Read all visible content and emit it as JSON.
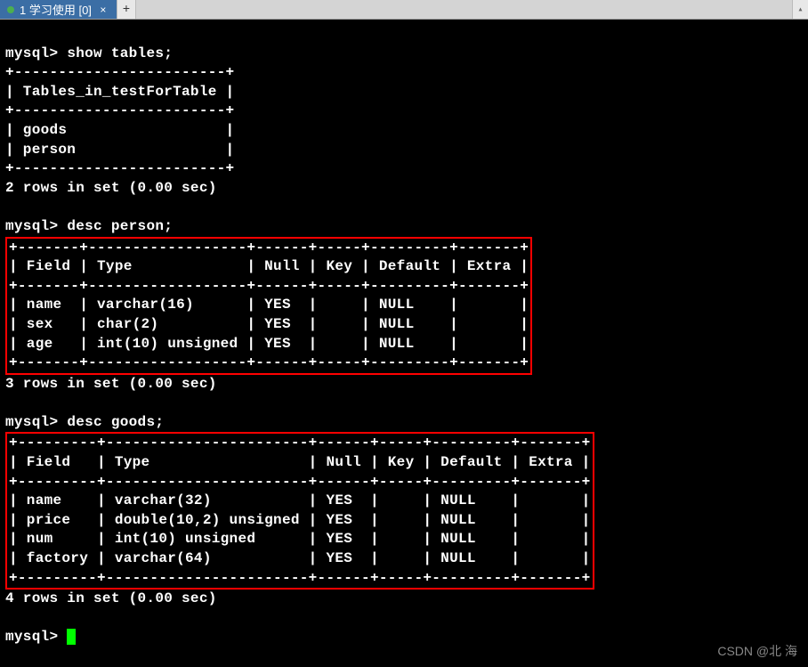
{
  "tab": {
    "label": "1 学习使用 [0]",
    "close_glyph": "×",
    "add_glyph": "+",
    "scroll_glyph": "▴"
  },
  "prompt": "mysql>",
  "commands": {
    "show_tables": "show tables;",
    "desc_person": "desc person;",
    "desc_goods": "desc goods;"
  },
  "show_tables": {
    "border": "+------------------------+",
    "header": "| Tables_in_testForTable |",
    "rows": [
      "| goods                  |",
      "| person                 |"
    ],
    "summary": "2 rows in set (0.00 sec)"
  },
  "desc_person": {
    "border": "+-------+------------------+------+-----+---------+-------+",
    "header": "| Field | Type             | Null | Key | Default | Extra |",
    "rows": [
      "| name  | varchar(16)      | YES  |     | NULL    |       |",
      "| sex   | char(2)          | YES  |     | NULL    |       |",
      "| age   | int(10) unsigned | YES  |     | NULL    |       |"
    ],
    "summary": "3 rows in set (0.00 sec)"
  },
  "desc_goods": {
    "border": "+---------+-----------------------+------+-----+---------+-------+",
    "header": "| Field   | Type                  | Null | Key | Default | Extra |",
    "rows": [
      "| name    | varchar(32)           | YES  |     | NULL    |       |",
      "| price   | double(10,2) unsigned | YES  |     | NULL    |       |",
      "| num     | int(10) unsigned      | YES  |     | NULL    |       |",
      "| factory | varchar(64)           | YES  |     | NULL    |       |"
    ],
    "summary": "4 rows in set (0.00 sec)"
  },
  "watermark": "CSDN @北   海"
}
